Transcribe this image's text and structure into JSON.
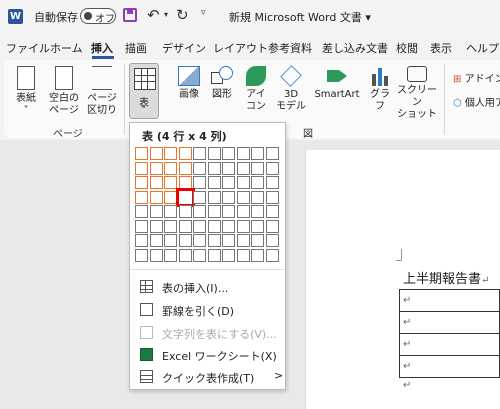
{
  "titlebar": {
    "word_icon": "W",
    "autosave_label": "自動保存",
    "autosave_state": "オフ",
    "doc_title": "新規 Microsoft Word 文書 ▾",
    "icons": [
      "word-logo-icon",
      "save-icon",
      "undo-icon",
      "redo-icon",
      "customize-qat-icon"
    ]
  },
  "tabs": [
    "ファイル",
    "ホーム",
    "挿入",
    "描画",
    "デザイン",
    "レイアウト",
    "参考資料",
    "差し込み文書",
    "校閲",
    "表示",
    "ヘルプ"
  ],
  "active_tab": "挿入",
  "ribbon": {
    "pages_group": {
      "cover": "表紙",
      "cover_caret": "˅",
      "blank_page_1": "空白の",
      "blank_page_2": "ページ",
      "page_break_1": "ページ",
      "page_break_2": "区切り",
      "label": "ページ"
    },
    "table_button": {
      "label": "表",
      "caret": "˅"
    },
    "illustrations_group": {
      "picture": "画像",
      "shapes": "図形",
      "icons_1": "アイ",
      "icons_2": "コン",
      "models_1": "3D",
      "models_2": "モデル",
      "smartart": "SmartArt",
      "chart": "グラフ",
      "screenshot_1": "スクリーン",
      "screenshot_2": "ショット",
      "label": "図"
    },
    "addins": {
      "get_addins": "アドインを",
      "personal": "個人用ア"
    }
  },
  "dropdown": {
    "title": "表 (4 行 x 4 列)",
    "grid": {
      "rows": 8,
      "cols": 10,
      "selected_rows": 4,
      "selected_cols": 4
    },
    "items": [
      {
        "label": "表の挿入(I)...",
        "icon": "insert-table-icon",
        "enabled": true
      },
      {
        "label": "罫線を引く(D)",
        "icon": "draw-table-icon",
        "enabled": true
      },
      {
        "label": "文字列を表にする(V)...",
        "icon": "convert-text-icon",
        "enabled": false
      },
      {
        "label": "Excel ワークシート(X)",
        "icon": "excel-icon",
        "enabled": true
      },
      {
        "label": "クイック表作成(T)",
        "icon": "quick-tables-icon",
        "enabled": true,
        "submenu": ">"
      }
    ]
  },
  "document": {
    "heading": "上半期報告書",
    "para_mark": "↵",
    "table_rows": 4
  },
  "colors": {
    "accent": "#2b579a",
    "grid_selected": "#e8742e",
    "cursor_cell": "#e00000"
  }
}
